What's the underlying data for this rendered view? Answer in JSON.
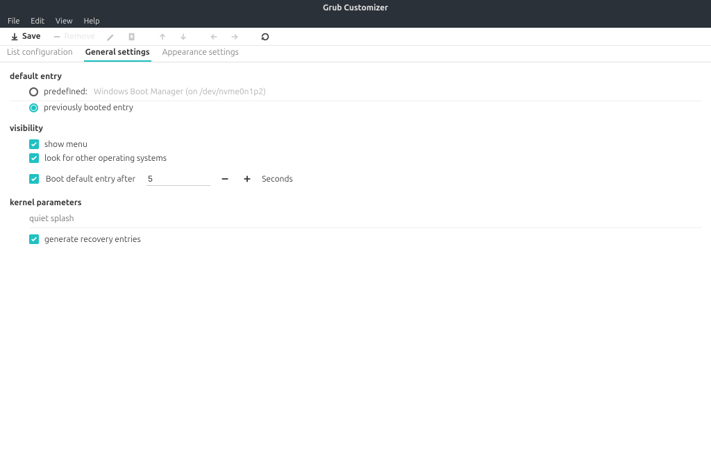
{
  "window": {
    "title": "Grub Customizer"
  },
  "menubar": {
    "items": [
      "File",
      "Edit",
      "View",
      "Help"
    ]
  },
  "toolbar": {
    "save_label": "Save",
    "remove_label": "Remove"
  },
  "tabs": [
    {
      "label": "List configuration",
      "active": false
    },
    {
      "label": "General settings",
      "active": true
    },
    {
      "label": "Appearance settings",
      "active": false
    }
  ],
  "sections": {
    "default_entry": {
      "title": "default entry",
      "predefined_label": "predefined:",
      "predefined_value": "Windows Boot Manager (on /dev/nvme0n1p2)",
      "previous_label": "previously booted entry",
      "selected": "previous"
    },
    "visibility": {
      "title": "visibility",
      "show_menu_label": "show menu",
      "show_menu_checked": true,
      "os_prober_label": "look for other operating systems",
      "os_prober_checked": true,
      "boot_default_label": "Boot default entry after",
      "boot_default_checked": true,
      "timeout_value": "5",
      "seconds_label": "Seconds"
    },
    "kernel": {
      "title": "kernel parameters",
      "params_value": "quiet splash",
      "recovery_label": "generate recovery entries",
      "recovery_checked": true
    }
  }
}
